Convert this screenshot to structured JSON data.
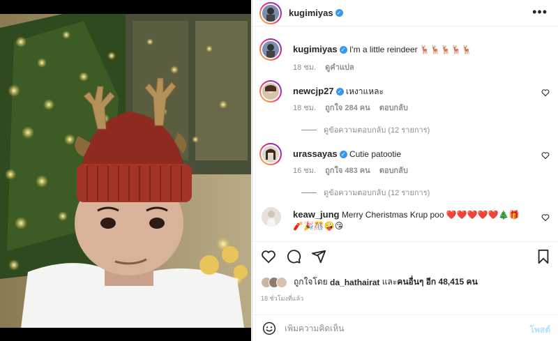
{
  "post": {
    "author": "kugimiyas",
    "options_icon": "more-horizontal-icon"
  },
  "caption": {
    "username": "kugimiyas",
    "text": "I'm a little reindeer 🦌🦌🦌🦌🦌",
    "time": "18 ชม.",
    "translate": "ดูคำแปล"
  },
  "comments": [
    {
      "username": "newcjp27",
      "verified": true,
      "text": "เหงาแหละ",
      "time": "18 ชม.",
      "likes": "ถูกใจ 284 คน",
      "reply": "ตอบกลับ",
      "view_replies": "ดูข้อความตอบกลับ (12 รายการ)"
    },
    {
      "username": "urassayas",
      "verified": true,
      "text": "Cutie patootie",
      "time": "16 ชม.",
      "likes": "ถูกใจ 483 คน",
      "reply": "ตอบกลับ",
      "view_replies": "ดูข้อความตอบกลับ (12 รายการ)"
    },
    {
      "username": "keaw_jung",
      "verified": false,
      "text": "Merry Cheristmas Krup poo ❤️❤️❤️❤️❤️🎄🎁🧨🎉🎊🤪😘"
    }
  ],
  "likes_summary": {
    "prefix": "ถูกใจโดย",
    "user": "da_hathairat",
    "middle": "และ",
    "others": "คนอื่นๆ อีก 48,415 คน"
  },
  "timestamp": "18 ชั่วโมงที่แล้ว",
  "composer": {
    "placeholder": "เพิ่มความคิดเห็น",
    "post_label": "โพสต์"
  },
  "colors": {
    "verified": "#3897f0",
    "post_disabled": "#b2dffc",
    "muted": "#8e8e8e"
  }
}
